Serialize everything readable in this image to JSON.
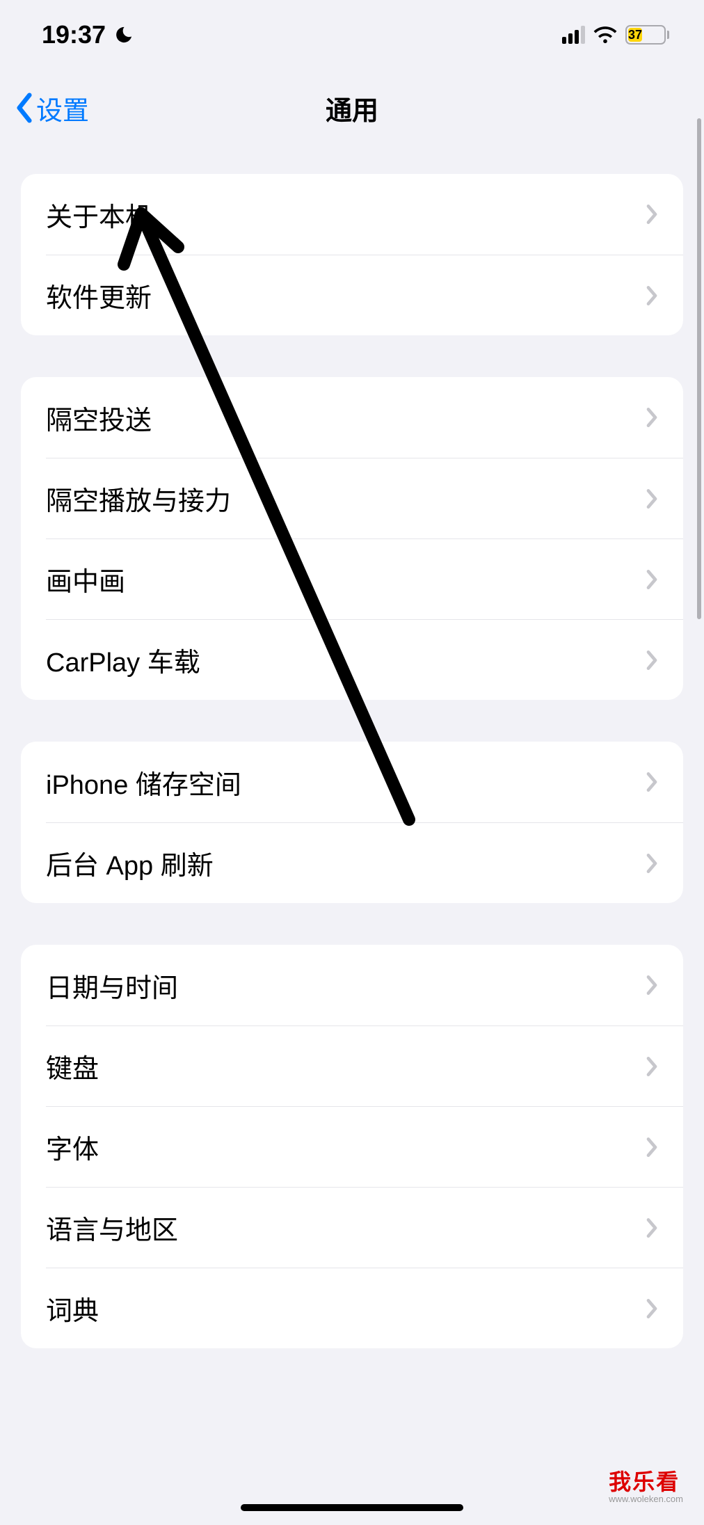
{
  "status": {
    "time": "19:37",
    "battery_pct": "37",
    "battery_fill_pct": 40
  },
  "nav": {
    "back_label": "设置",
    "title": "通用"
  },
  "groups": [
    {
      "rows": [
        {
          "label": "关于本机"
        },
        {
          "label": "软件更新"
        }
      ]
    },
    {
      "rows": [
        {
          "label": "隔空投送"
        },
        {
          "label": "隔空播放与接力"
        },
        {
          "label": "画中画"
        },
        {
          "label": "CarPlay 车载"
        }
      ]
    },
    {
      "rows": [
        {
          "label": "iPhone 储存空间"
        },
        {
          "label": "后台 App 刷新"
        }
      ]
    },
    {
      "rows": [
        {
          "label": "日期与时间"
        },
        {
          "label": "键盘"
        },
        {
          "label": "字体"
        },
        {
          "label": "语言与地区"
        },
        {
          "label": "词典"
        }
      ]
    }
  ],
  "watermark": {
    "main": "我乐看",
    "sub": "www.woleken.com"
  }
}
